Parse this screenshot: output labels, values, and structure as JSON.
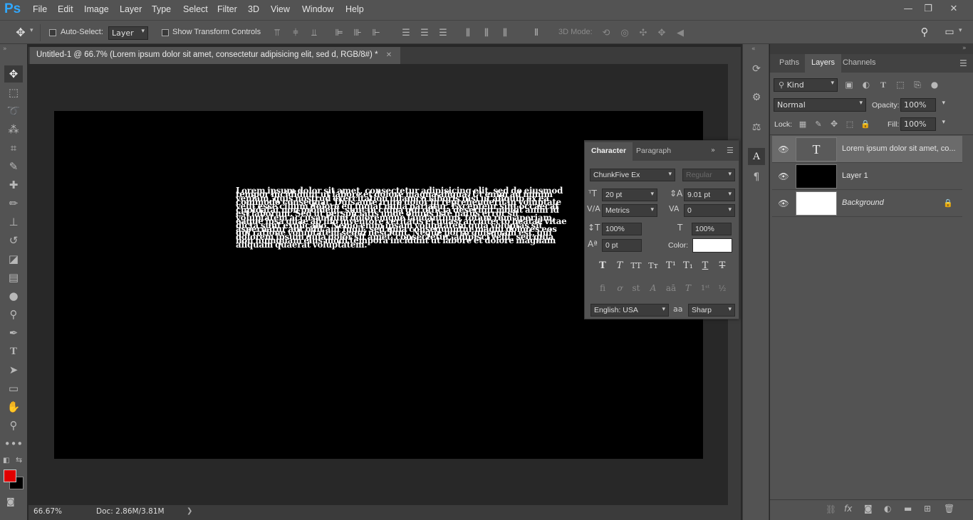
{
  "app": {
    "logo": "Ps"
  },
  "menu": [
    "File",
    "Edit",
    "Image",
    "Layer",
    "Type",
    "Select",
    "Filter",
    "3D",
    "View",
    "Window",
    "Help"
  ],
  "window_controls": {
    "minimize": "—",
    "restore": "❐",
    "close": "✕"
  },
  "options": {
    "auto_select_label": "Auto-Select:",
    "auto_select_value": "Layer",
    "show_transform_label": "Show Transform Controls",
    "mode_3d_label": "3D Mode:"
  },
  "document": {
    "tab_title": "Untitled-1 @ 66.7% (Lorem ipsum dolor sit amet, consectetur adipisicing elit, sed d, RGB/8#) *",
    "close": "✕"
  },
  "canvas": {
    "text": "Lorem ipsum dolor sit amet, consectetur adipisicing elit, sed do eiusmod tempor incididunt ut labore et dolore magna aliqua. Ut enim ad minim veniam, quis nostrud exercitation ullamco laboris nisi ut aliquip ex ea commodo consequat. Duis aute irure dolor in reprehenderit in voluptate velit esse cillum dolore eu fugiat nulla pariatur. Excepteur sint occaecat cupidatat non proident, sunt in culpa qui officia deserunt mollit anim id est laborum. Sed ut perspiciatis unde omnis iste natus error sit voluptatem accusantium doloremque laudantium, totam rem aperiam, eaque ipsa quae ab illo inventore veritatis et quasi architecto beatae vitae dicta sunt explicabo. Nemo enim ipsam voluptatem quia voluptas sit aspernatur aut odit aut fugit, sed quia consequuntur magni dolores eos qui ratione voluptatem sequi nesciunt. Neque porro quisquam est, qui dolorem ipsum quia dolor sit amet, consectetur, adipisci velit, sed quia non numquam eius modi tempora incidunt ut labore et dolore magnam aliquam quaerat voluptatem."
  },
  "status": {
    "zoom": "66.67%",
    "doc": "Doc: 2.86M/3.81M",
    "arrow": "❯"
  },
  "colors": {
    "foreground": "#e00000",
    "background": "#000000",
    "accent": "#31a8ff"
  },
  "panels": {
    "tabs": [
      "Paths",
      "Layers",
      "Channels"
    ],
    "filter_kind": "Kind",
    "blend_mode": "Normal",
    "opacity_label": "Opacity:",
    "opacity_value": "100%",
    "lock_label": "Lock:",
    "fill_label": "Fill:",
    "fill_value": "100%",
    "layers": [
      {
        "name": "Lorem ipsum dolor sit amet, co...",
        "type": "text",
        "selected": true,
        "thumb_glyph": "T"
      },
      {
        "name": "Layer 1",
        "type": "pixel",
        "selected": false,
        "thumb_glyph": ""
      },
      {
        "name": "Background",
        "type": "background",
        "selected": false,
        "thumb_glyph": ""
      }
    ]
  },
  "character": {
    "tabs": [
      "Character",
      "Paragraph"
    ],
    "font_family": "ChunkFive Ex",
    "font_style": "Regular",
    "size": "20 pt",
    "leading": "9.01 pt",
    "kerning": "Metrics",
    "tracking": "0",
    "vscale": "100%",
    "hscale": "100%",
    "baseline": "0 pt",
    "color_label": "Color:",
    "color_value": "#ffffff",
    "language": "English: USA",
    "antialias": "Sharp",
    "aa_icon": "aa"
  }
}
